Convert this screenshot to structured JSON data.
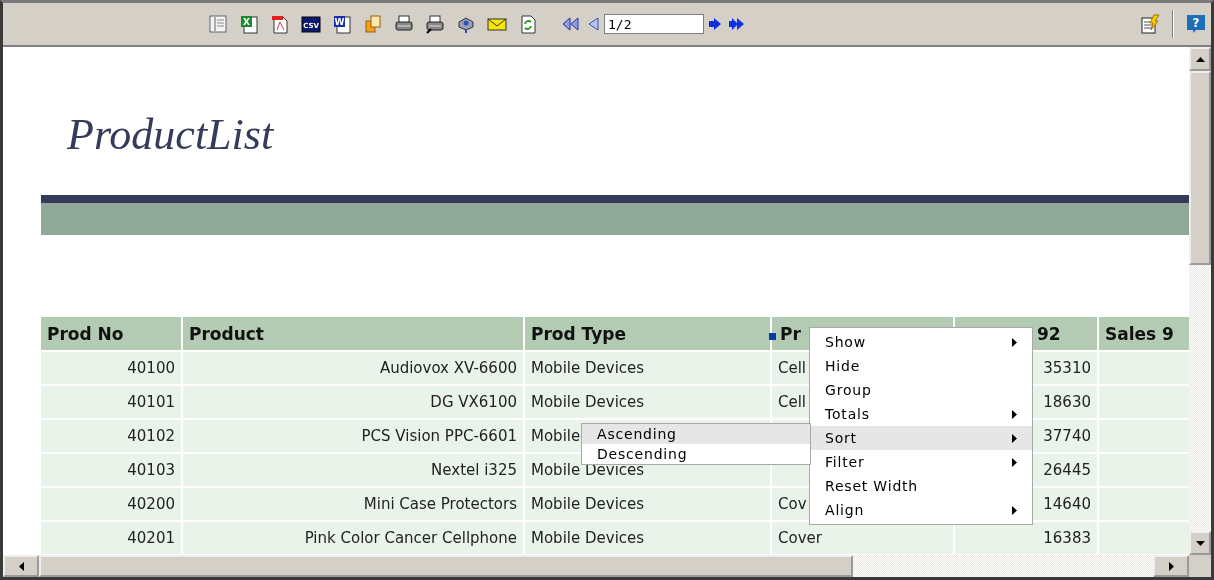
{
  "toolbar": {
    "buttons": [
      {
        "kind": "list"
      },
      {
        "kind": "excel",
        "glyph": "X"
      },
      {
        "kind": "pdf"
      },
      {
        "kind": "csv",
        "glyph": "CSV"
      },
      {
        "kind": "word",
        "glyph": "W"
      },
      {
        "kind": "copy"
      },
      {
        "kind": "print"
      },
      {
        "kind": "print-setup"
      },
      {
        "kind": "device"
      },
      {
        "kind": "mail"
      },
      {
        "kind": "refresh"
      }
    ],
    "page_field": {
      "value": "1/2"
    },
    "right_buttons": [
      {
        "kind": "edit"
      },
      {
        "kind": "help",
        "glyph": "?"
      }
    ]
  },
  "report": {
    "title": "ProductList"
  },
  "table": {
    "columns": [
      "Prod No",
      "Product",
      "Prod Type",
      "Pr",
      "92",
      "Sales 9"
    ],
    "rows": [
      {
        "cells": [
          "40100",
          "Audiovox XV-6600",
          "Mobile Devices",
          "Cell",
          "35310",
          null
        ]
      },
      {
        "cells": [
          "40101",
          "DG VX6100",
          "Mobile Devices",
          "Cell",
          "18630",
          null
        ]
      },
      {
        "cells": [
          "40102",
          "PCS Vision PPC-6601",
          "Mobile",
          null,
          "37740",
          null
        ]
      },
      {
        "cells": [
          "40103",
          "Nextel i325",
          "Mobile Devices",
          null,
          "26445",
          null
        ]
      },
      {
        "cells": [
          "40200",
          "Mini Case Protectors",
          "Mobile Devices",
          "Cov",
          "14640",
          null
        ]
      },
      {
        "cells": [
          "40201",
          "Pink Color Cancer Cellphone",
          "Mobile Devices",
          "Cover",
          "16383",
          null
        ]
      }
    ]
  },
  "column_menu": {
    "items": [
      {
        "label": "Show",
        "submenu": true,
        "selected": false
      },
      {
        "label": "Hide",
        "submenu": false,
        "selected": false
      },
      {
        "label": "Group",
        "submenu": false,
        "selected": false
      },
      {
        "label": "Totals",
        "submenu": true,
        "selected": false
      },
      {
        "label": "Sort",
        "submenu": true,
        "selected": true
      },
      {
        "label": "Filter",
        "submenu": true,
        "selected": false
      },
      {
        "label": "Reset Width",
        "submenu": false,
        "selected": false
      },
      {
        "label": "Align",
        "submenu": true,
        "selected": false
      }
    ]
  },
  "sort_submenu": {
    "items": [
      {
        "label": "Ascending",
        "selected": true
      },
      {
        "label": "Descending",
        "selected": false
      }
    ]
  }
}
